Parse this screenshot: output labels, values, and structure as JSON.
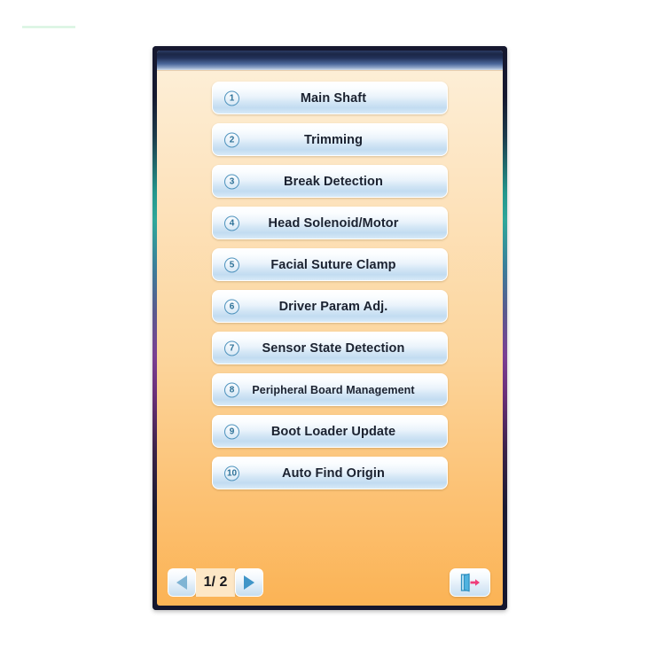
{
  "window": {
    "titlebar_text": "",
    "bezel_accent": "#2fa79a",
    "screen_bg_top": "#fdf0da",
    "screen_bg_bottom": "#fbb355"
  },
  "menu": {
    "items": [
      {
        "number": "1",
        "label": "Main Shaft"
      },
      {
        "number": "2",
        "label": "Trimming"
      },
      {
        "number": "3",
        "label": "Break Detection"
      },
      {
        "number": "4",
        "label": "Head Solenoid/Motor"
      },
      {
        "number": "5",
        "label": "Facial Suture Clamp"
      },
      {
        "number": "6",
        "label": "Driver Param Adj."
      },
      {
        "number": "7",
        "label": "Sensor State Detection"
      },
      {
        "number": "8",
        "label": "Peripheral Board Management"
      },
      {
        "number": "9",
        "label": "Boot Loader Update"
      },
      {
        "number": "10",
        "label": "Auto Find Origin"
      }
    ]
  },
  "footer": {
    "prev_icon": "triangle-left-icon",
    "next_icon": "triangle-right-icon",
    "page_indicator": "1/ 2",
    "current_page": "1",
    "total_pages": "2",
    "exit_icon": "exit-door-icon",
    "exit_door_color": "#3fa9d8",
    "exit_arrow_color": "#ef3d7a"
  }
}
